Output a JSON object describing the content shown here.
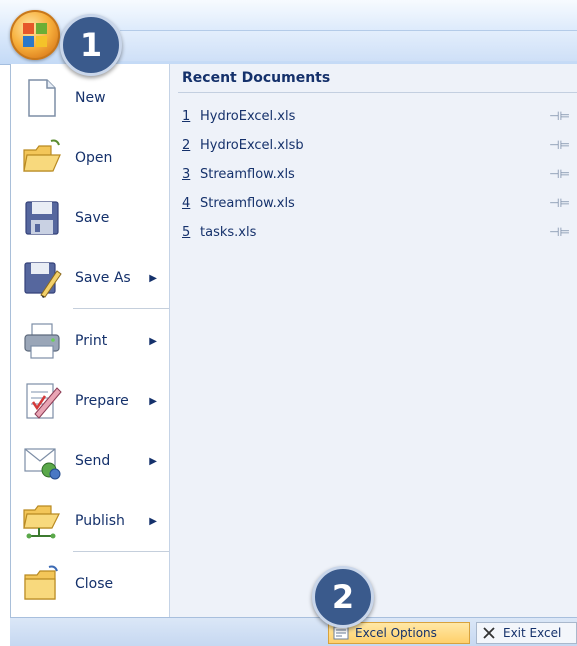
{
  "callouts": [
    "1",
    "2"
  ],
  "commands": [
    {
      "label": "New",
      "icon": "new-document-icon",
      "has_submenu": false
    },
    {
      "label": "Open",
      "icon": "open-folder-icon",
      "has_submenu": false
    },
    {
      "label": "Save",
      "icon": "save-disk-icon",
      "has_submenu": false
    },
    {
      "label": "Save As",
      "icon": "save-as-icon",
      "has_submenu": true
    },
    {
      "label": "Print",
      "icon": "printer-icon",
      "has_submenu": true
    },
    {
      "label": "Prepare",
      "icon": "prepare-icon",
      "has_submenu": true
    },
    {
      "label": "Send",
      "icon": "send-icon",
      "has_submenu": true
    },
    {
      "label": "Publish",
      "icon": "publish-icon",
      "has_submenu": true
    },
    {
      "label": "Close",
      "icon": "close-folder-icon",
      "has_submenu": false
    }
  ],
  "recent": {
    "title": "Recent Documents",
    "items": [
      {
        "num": "1",
        "name": "HydroExcel.xls"
      },
      {
        "num": "2",
        "name": "HydroExcel.xlsb"
      },
      {
        "num": "3",
        "name": "Streamflow.xls"
      },
      {
        "num": "4",
        "name": "Streamflow.xls"
      },
      {
        "num": "5",
        "name": "tasks.xls"
      }
    ],
    "pin_glyph": "⊣⊨"
  },
  "bottom": {
    "excel_options": "Excel Options",
    "exit_excel": "Exit Excel"
  },
  "colors": {
    "text": "#15316b",
    "callout": "#3a5a8c",
    "accent_button": "#ffd06a"
  }
}
